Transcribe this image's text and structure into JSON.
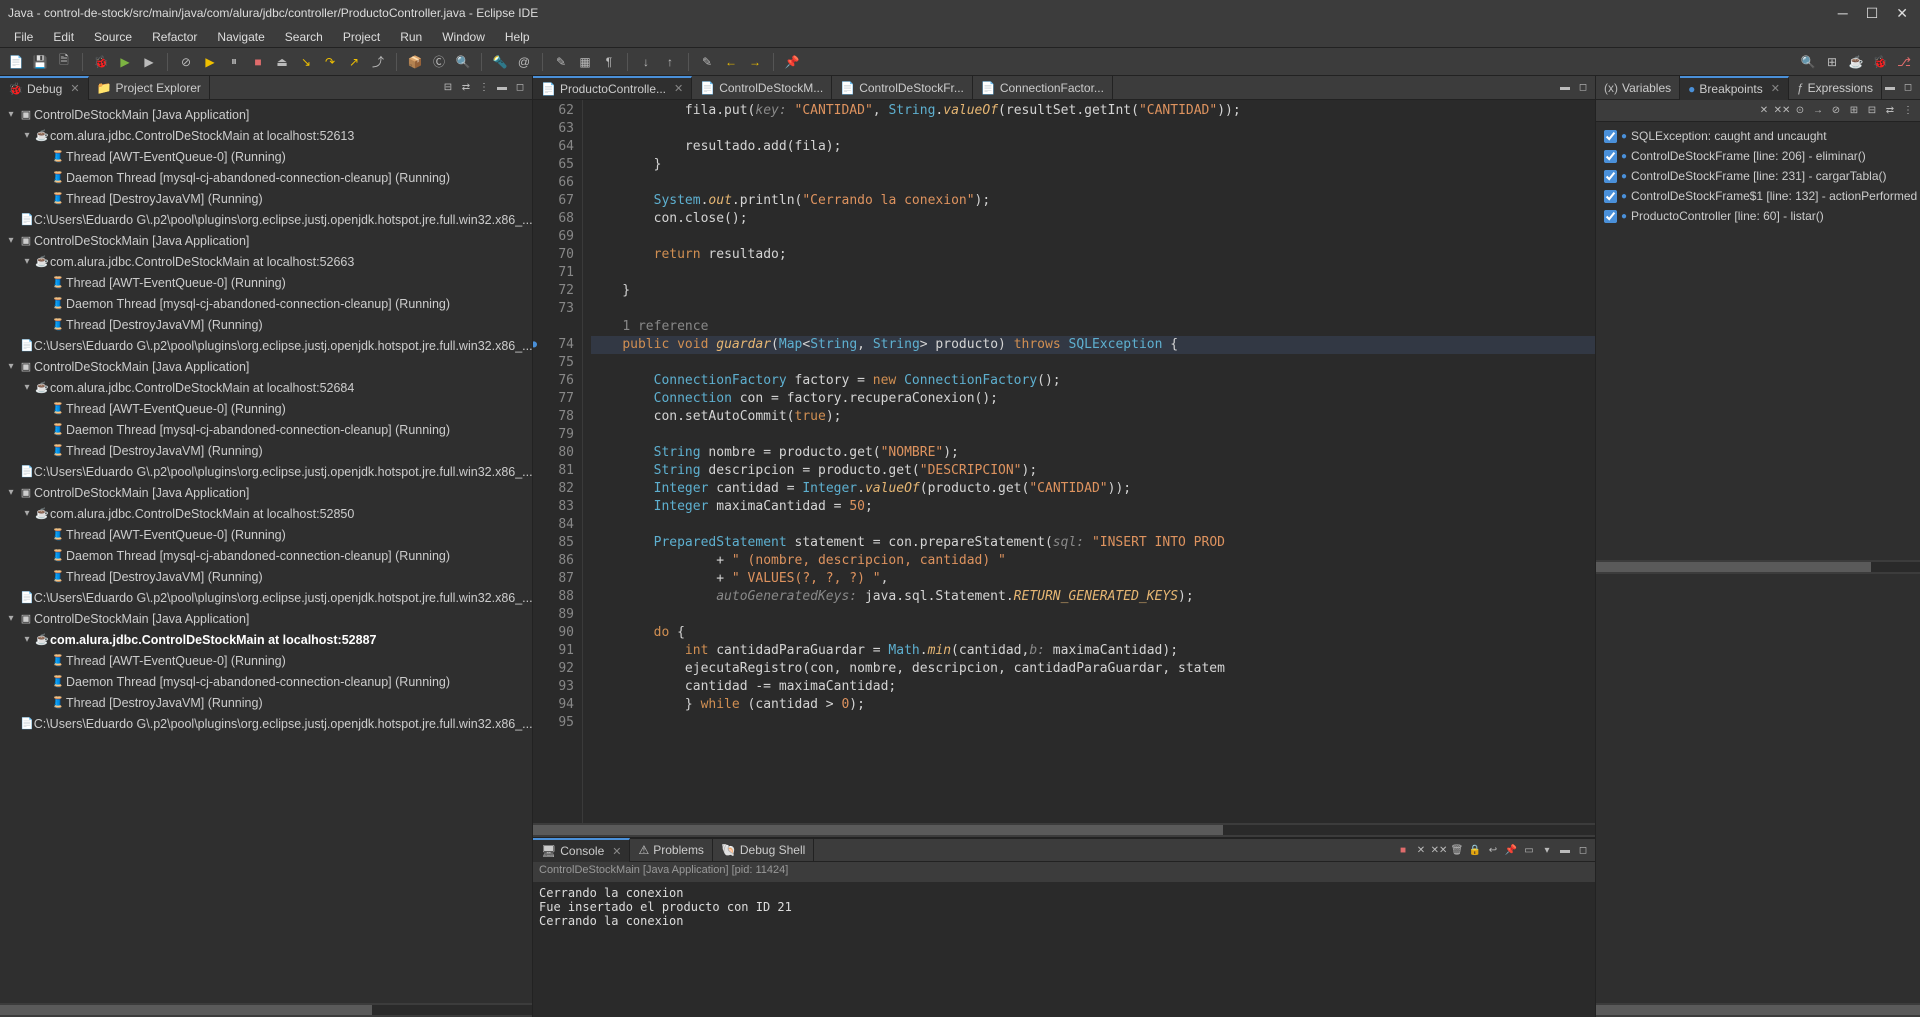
{
  "titlebar": {
    "title": "Java - control-de-stock/src/main/java/com/alura/jdbc/controller/ProductoController.java - Eclipse IDE"
  },
  "menubar": [
    "File",
    "Edit",
    "Source",
    "Refactor",
    "Navigate",
    "Search",
    "Project",
    "Run",
    "Window",
    "Help"
  ],
  "left": {
    "tabs": [
      {
        "label": "Debug",
        "active": true
      },
      {
        "label": "Project Explorer",
        "active": false
      }
    ],
    "tree": [
      {
        "indent": 0,
        "twist": "▾",
        "icon": "▣",
        "label": "ControlDeStockMain [Java Application]",
        "bold": false
      },
      {
        "indent": 1,
        "twist": "▾",
        "icon": "☕",
        "label": "com.alura.jdbc.ControlDeStockMain at localhost:52613",
        "bold": false
      },
      {
        "indent": 2,
        "twist": "",
        "icon": "🧵",
        "label": "Thread [AWT-EventQueue-0] (Running)",
        "bold": false
      },
      {
        "indent": 2,
        "twist": "",
        "icon": "🧵",
        "label": "Daemon Thread [mysql-cj-abandoned-connection-cleanup] (Running)",
        "bold": false
      },
      {
        "indent": 2,
        "twist": "",
        "icon": "🧵",
        "label": "Thread [DestroyJavaVM] (Running)",
        "bold": false
      },
      {
        "indent": 1,
        "twist": "",
        "icon": "📄",
        "label": "C:\\Users\\Eduardo G\\.p2\\pool\\plugins\\org.eclipse.justj.openjdk.hotspot.jre.full.win32.x86_...",
        "bold": false
      },
      {
        "indent": 0,
        "twist": "▾",
        "icon": "▣",
        "label": "ControlDeStockMain [Java Application]",
        "bold": false
      },
      {
        "indent": 1,
        "twist": "▾",
        "icon": "☕",
        "label": "com.alura.jdbc.ControlDeStockMain at localhost:52663",
        "bold": false
      },
      {
        "indent": 2,
        "twist": "",
        "icon": "🧵",
        "label": "Thread [AWT-EventQueue-0] (Running)",
        "bold": false
      },
      {
        "indent": 2,
        "twist": "",
        "icon": "🧵",
        "label": "Daemon Thread [mysql-cj-abandoned-connection-cleanup] (Running)",
        "bold": false
      },
      {
        "indent": 2,
        "twist": "",
        "icon": "🧵",
        "label": "Thread [DestroyJavaVM] (Running)",
        "bold": false
      },
      {
        "indent": 1,
        "twist": "",
        "icon": "📄",
        "label": "C:\\Users\\Eduardo G\\.p2\\pool\\plugins\\org.eclipse.justj.openjdk.hotspot.jre.full.win32.x86_...",
        "bold": false
      },
      {
        "indent": 0,
        "twist": "▾",
        "icon": "▣",
        "label": "ControlDeStockMain [Java Application]",
        "bold": false
      },
      {
        "indent": 1,
        "twist": "▾",
        "icon": "☕",
        "label": "com.alura.jdbc.ControlDeStockMain at localhost:52684",
        "bold": false
      },
      {
        "indent": 2,
        "twist": "",
        "icon": "🧵",
        "label": "Thread [AWT-EventQueue-0] (Running)",
        "bold": false
      },
      {
        "indent": 2,
        "twist": "",
        "icon": "🧵",
        "label": "Daemon Thread [mysql-cj-abandoned-connection-cleanup] (Running)",
        "bold": false
      },
      {
        "indent": 2,
        "twist": "",
        "icon": "🧵",
        "label": "Thread [DestroyJavaVM] (Running)",
        "bold": false
      },
      {
        "indent": 1,
        "twist": "",
        "icon": "📄",
        "label": "C:\\Users\\Eduardo G\\.p2\\pool\\plugins\\org.eclipse.justj.openjdk.hotspot.jre.full.win32.x86_...",
        "bold": false
      },
      {
        "indent": 0,
        "twist": "▾",
        "icon": "▣",
        "label": "ControlDeStockMain [Java Application]",
        "bold": false
      },
      {
        "indent": 1,
        "twist": "▾",
        "icon": "☕",
        "label": "com.alura.jdbc.ControlDeStockMain at localhost:52850",
        "bold": false
      },
      {
        "indent": 2,
        "twist": "",
        "icon": "🧵",
        "label": "Thread [AWT-EventQueue-0] (Running)",
        "bold": false
      },
      {
        "indent": 2,
        "twist": "",
        "icon": "🧵",
        "label": "Daemon Thread [mysql-cj-abandoned-connection-cleanup] (Running)",
        "bold": false
      },
      {
        "indent": 2,
        "twist": "",
        "icon": "🧵",
        "label": "Thread [DestroyJavaVM] (Running)",
        "bold": false
      },
      {
        "indent": 1,
        "twist": "",
        "icon": "📄",
        "label": "C:\\Users\\Eduardo G\\.p2\\pool\\plugins\\org.eclipse.justj.openjdk.hotspot.jre.full.win32.x86_...",
        "bold": false
      },
      {
        "indent": 0,
        "twist": "▾",
        "icon": "▣",
        "label": "ControlDeStockMain [Java Application]",
        "bold": false
      },
      {
        "indent": 1,
        "twist": "▾",
        "icon": "☕",
        "label": "com.alura.jdbc.ControlDeStockMain at localhost:52887",
        "bold": true
      },
      {
        "indent": 2,
        "twist": "",
        "icon": "🧵",
        "label": "Thread [AWT-EventQueue-0] (Running)",
        "bold": false
      },
      {
        "indent": 2,
        "twist": "",
        "icon": "🧵",
        "label": "Daemon Thread [mysql-cj-abandoned-connection-cleanup] (Running)",
        "bold": false
      },
      {
        "indent": 2,
        "twist": "",
        "icon": "🧵",
        "label": "Thread [DestroyJavaVM] (Running)",
        "bold": false
      },
      {
        "indent": 1,
        "twist": "",
        "icon": "📄",
        "label": "C:\\Users\\Eduardo G\\.p2\\pool\\plugins\\org.eclipse.justj.openjdk.hotspot.jre.full.win32.x86_...",
        "bold": false
      }
    ]
  },
  "editor": {
    "tabs": [
      {
        "label": "ProductoControlle...",
        "active": true
      },
      {
        "label": "ControlDeStockM...",
        "active": false
      },
      {
        "label": "ControlDeStockFr...",
        "active": false
      },
      {
        "label": "ConnectionFactor...",
        "active": false
      }
    ],
    "first_line": 62,
    "breakpoint_lines": [
      74
    ],
    "codelens_before": 74,
    "codelens_text": "1 reference",
    "lines": [
      {
        "n": 62,
        "html": "            fila.put(<span class='pname'>key:</span> <span class='str'>\"CANTIDAD\"</span>, <span class='type'>String</span>.<span class='fn'>valueOf</span>(resultSet.getInt(<span class='str'>\"CANTIDAD\"</span>));"
      },
      {
        "n": 63,
        "html": ""
      },
      {
        "n": 64,
        "html": "            resultado.add(fila);"
      },
      {
        "n": 65,
        "html": "        }"
      },
      {
        "n": 66,
        "html": ""
      },
      {
        "n": 67,
        "html": "        <span class='type'>System</span>.<span class='fn'>out</span>.println(<span class='str'>\"Cerrando la conexion\"</span>);"
      },
      {
        "n": 68,
        "html": "        con.close();"
      },
      {
        "n": 69,
        "html": ""
      },
      {
        "n": 70,
        "html": "        <span class='kw'>return</span> resultado;"
      },
      {
        "n": 71,
        "html": ""
      },
      {
        "n": 72,
        "html": "    }"
      },
      {
        "n": 73,
        "html": ""
      },
      {
        "n": 74,
        "html": "    <span class='kw'>public</span> <span class='kw'>void</span> <span class='fn'>guardar</span>(<span class='type'>Map</span>&lt;<span class='type'>String</span>, <span class='type'>String</span>&gt; producto) <span class='kw'>throws</span> <span class='type'>SQLException</span> {"
      },
      {
        "n": 75,
        "html": ""
      },
      {
        "n": 76,
        "html": "        <span class='type'>ConnectionFactory</span> factory = <span class='kw'>new</span> <span class='type'>ConnectionFactory</span>();"
      },
      {
        "n": 77,
        "html": "        <span class='type'>Connection</span> con = factory.recuperaConexion();"
      },
      {
        "n": 78,
        "html": "        con.setAutoCommit(<span class='kw'>true</span>);"
      },
      {
        "n": 79,
        "html": ""
      },
      {
        "n": 80,
        "html": "        <span class='type'>String</span> nombre = producto.get(<span class='str'>\"NOMBRE\"</span>);"
      },
      {
        "n": 81,
        "html": "        <span class='type'>String</span> descripcion = producto.get(<span class='str'>\"DESCRIPCION\"</span>);"
      },
      {
        "n": 82,
        "html": "        <span class='type'>Integer</span> cantidad = <span class='type'>Integer</span>.<span class='fn'>valueOf</span>(producto.get(<span class='str'>\"CANTIDAD\"</span>));"
      },
      {
        "n": 83,
        "html": "        <span class='type'>Integer</span> maximaCantidad = <span class='num'>50</span>;"
      },
      {
        "n": 84,
        "html": ""
      },
      {
        "n": 85,
        "html": "        <span class='type'>PreparedStatement</span> statement = con.prepareStatement(<span class='pname'>sql:</span> <span class='str'>\"INSERT INTO PROD</span>"
      },
      {
        "n": 86,
        "html": "                + <span class='str'>\" (nombre, descripcion, cantidad) \"</span>"
      },
      {
        "n": 87,
        "html": "                + <span class='str'>\" VALUES(?, ?, ?) \"</span>,"
      },
      {
        "n": 88,
        "html": "                <span class='pname'>autoGeneratedKeys:</span> java.sql.Statement.<span class='fn'>RETURN_GENERATED_KEYS</span>);"
      },
      {
        "n": 89,
        "html": ""
      },
      {
        "n": 90,
        "html": "        <span class='kw'>do</span> {"
      },
      {
        "n": 91,
        "html": "            <span class='kw'>int</span> cantidadParaGuardar = <span class='type'>Math</span>.<span class='fn'>min</span>(cantidad,<span class='pname'>b:</span> maximaCantidad);"
      },
      {
        "n": 92,
        "html": "            ejecutaRegistro(con, nombre, descripcion, cantidadParaGuardar, statem"
      },
      {
        "n": 93,
        "html": "            cantidad -= maximaCantidad;"
      },
      {
        "n": 94,
        "html": "            } <span class='kw'>while</span> (cantidad &gt; <span class='num'>0</span>);"
      },
      {
        "n": 95,
        "html": ""
      }
    ]
  },
  "bottom": {
    "tabs": [
      {
        "label": "Console",
        "active": true
      },
      {
        "label": "Problems",
        "active": false
      },
      {
        "label": "Debug Shell",
        "active": false
      }
    ],
    "console_head": "ControlDeStockMain [Java Application]  [pid: 11424]",
    "console_lines": [
      "Cerrando la conexion",
      "Fue insertado el producto con ID 21",
      "Cerrando la conexion"
    ]
  },
  "right": {
    "tabs": [
      {
        "label": "Variables",
        "active": false
      },
      {
        "label": "Breakpoints",
        "active": true
      },
      {
        "label": "Expressions",
        "active": false
      }
    ],
    "breakpoints": [
      {
        "checked": true,
        "label": "SQLException: caught and uncaught"
      },
      {
        "checked": true,
        "label": "ControlDeStockFrame [line: 206] - eliminar()"
      },
      {
        "checked": true,
        "label": "ControlDeStockFrame [line: 231] - cargarTabla()"
      },
      {
        "checked": true,
        "label": "ControlDeStockFrame$1 [line: 132] - actionPerformed"
      },
      {
        "checked": true,
        "label": "ProductoController [line: 60] - listar()"
      }
    ]
  }
}
